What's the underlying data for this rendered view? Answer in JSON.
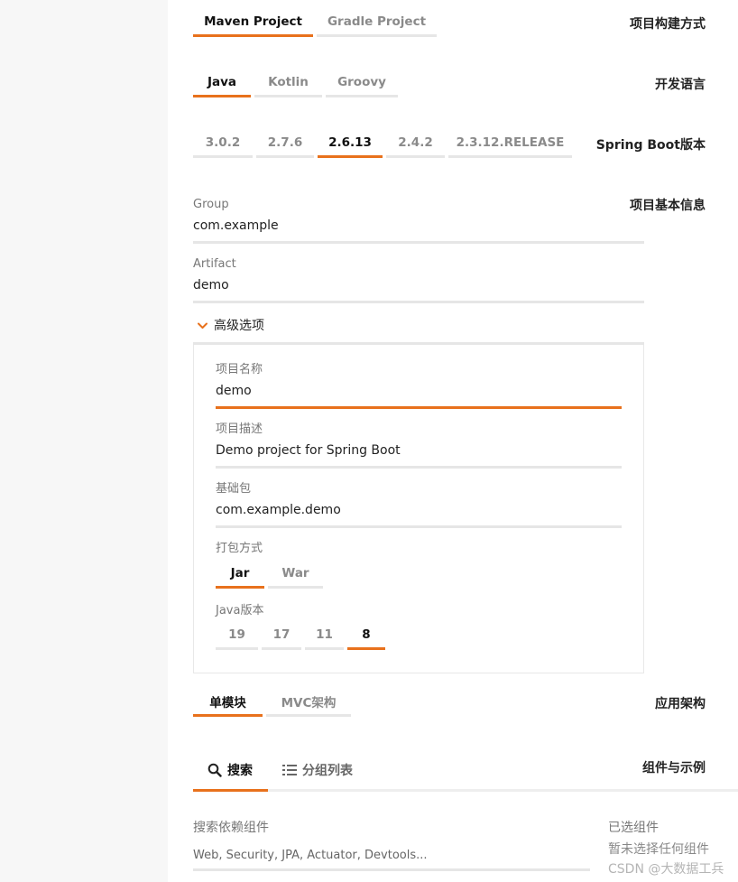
{
  "rows": {
    "build": "项目构建方式",
    "language": "开发语言",
    "boot": "Spring Boot版本",
    "info": "项目基本信息",
    "arch": "应用架构",
    "deps": "组件与示例"
  },
  "build_options": [
    {
      "label": "Maven Project",
      "active": true
    },
    {
      "label": "Gradle Project",
      "active": false
    }
  ],
  "language_options": [
    {
      "label": "Java",
      "active": true
    },
    {
      "label": "Kotlin",
      "active": false
    },
    {
      "label": "Groovy",
      "active": false
    }
  ],
  "boot_options": [
    {
      "label": "3.0.2",
      "active": false
    },
    {
      "label": "2.7.6",
      "active": false
    },
    {
      "label": "2.6.13",
      "active": true
    },
    {
      "label": "2.4.2",
      "active": false
    },
    {
      "label": "2.3.12.RELEASE",
      "active": false
    }
  ],
  "fields": {
    "group": {
      "label": "Group",
      "value": "com.example"
    },
    "artifact": {
      "label": "Artifact",
      "value": "demo"
    },
    "name": {
      "label": "项目名称",
      "value": "demo"
    },
    "description": {
      "label": "项目描述",
      "value": "Demo project for Spring Boot"
    },
    "package": {
      "label": "基础包",
      "value": "com.example.demo"
    }
  },
  "advanced": {
    "label": "高级选项",
    "icon": "chevron-down-icon",
    "expanded": true
  },
  "packaging": {
    "label": "打包方式",
    "options": [
      {
        "label": "Jar",
        "active": true
      },
      {
        "label": "War",
        "active": false
      }
    ]
  },
  "java_version": {
    "label": "Java版本",
    "options": [
      {
        "label": "19",
        "active": false
      },
      {
        "label": "17",
        "active": false
      },
      {
        "label": "11",
        "active": false
      },
      {
        "label": "8",
        "active": true
      }
    ]
  },
  "arch_options": [
    {
      "label": "单模块",
      "active": true
    },
    {
      "label": "MVC架构",
      "active": false
    }
  ],
  "dep_tabs": [
    {
      "label": "搜索",
      "icon": "search-icon",
      "active": true
    },
    {
      "label": "分组列表",
      "icon": "list-icon",
      "active": false
    }
  ],
  "search": {
    "label": "搜索依赖组件",
    "placeholder": "Web, Security, JPA, Actuator, Devtools..."
  },
  "selected": {
    "title": "已选组件",
    "empty": "暂未选择任何组件"
  },
  "watermark": "CSDN @大数据工兵",
  "colors": {
    "accent": "#e8711c",
    "inactive_line": "#e6e6e6",
    "sidebar_bg": "#f7f7f7"
  }
}
